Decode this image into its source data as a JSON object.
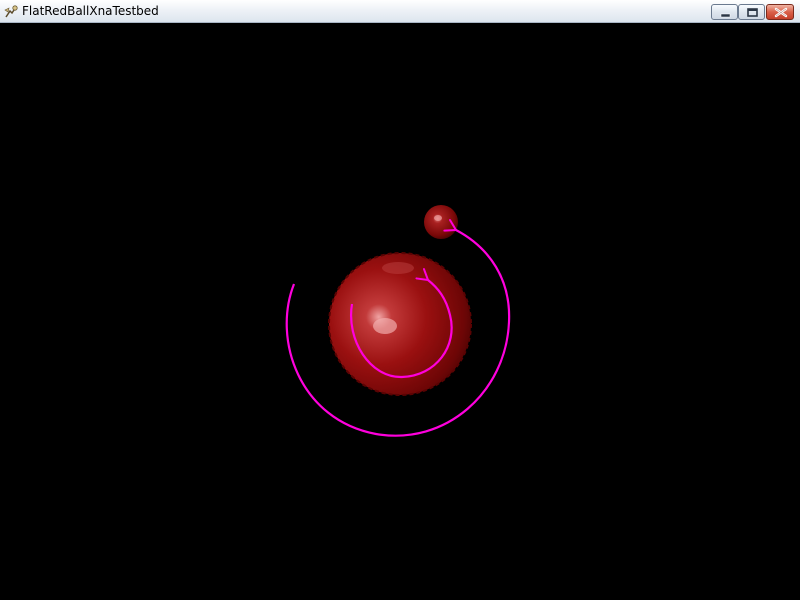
{
  "window": {
    "title": "FlatRedBallXnaTestbed",
    "icon": "flatredball-app-icon",
    "controls": {
      "minimize_icon": "minimize-icon",
      "maximize_icon": "maximize-icon",
      "close_icon": "close-icon"
    }
  },
  "scene": {
    "background_color": "#000000",
    "large_ball": {
      "color": "#8a0a0a",
      "highlight": "#e88b8b"
    },
    "small_ball": {
      "color": "#8a0a0a",
      "highlight": "#e88b8b"
    },
    "orbit_arrows": {
      "color": "#ff00dd"
    }
  }
}
